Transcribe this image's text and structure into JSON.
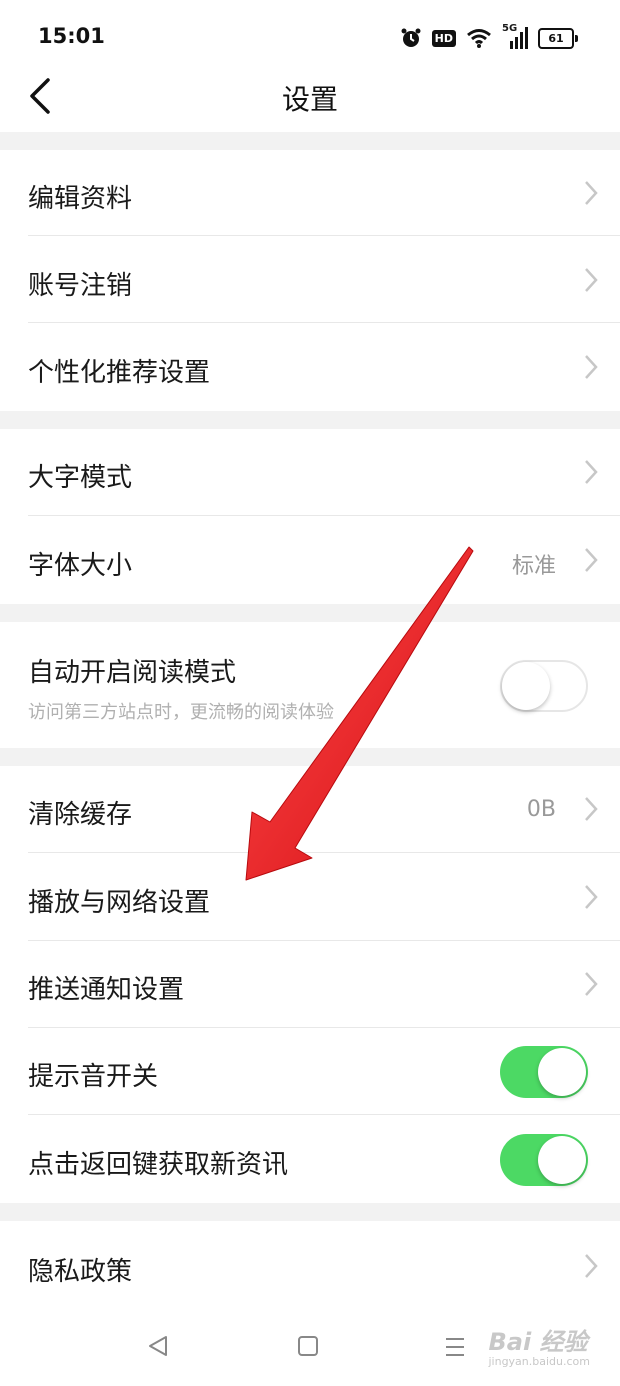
{
  "status_bar": {
    "time": "15:01",
    "hd": "HD",
    "signal": "5G",
    "battery": "61"
  },
  "header": {
    "title": "设置"
  },
  "sections": {
    "account": {
      "edit_profile": "编辑资料",
      "cancel_account": "账号注销",
      "personalized": "个性化推荐设置"
    },
    "display": {
      "large_text": "大字模式",
      "font_size": "字体大小",
      "font_size_value": "标准"
    },
    "reading": {
      "auto_read": "自动开启阅读模式",
      "auto_read_desc": "访问第三方站点时，更流畅的阅读体验",
      "auto_read_on": false
    },
    "misc": {
      "clear_cache": "清除缓存",
      "cache_value": "0B",
      "play_network": "播放与网络设置",
      "push_notify": "推送通知设置",
      "sound": "提示音开关",
      "sound_on": true,
      "back_refresh": "点击返回键获取新资讯",
      "back_refresh_on": true
    },
    "privacy": {
      "policy": "隐私政策"
    }
  },
  "watermark": {
    "brand": "Bai 经验",
    "url": "jingyan.baidu.com"
  },
  "colors": {
    "toggle_on": "#4cd964",
    "arrow": "#e3151a",
    "section_gap": "#f2f2f2"
  },
  "icons": [
    "back-chevron-icon",
    "chevron-right-icon",
    "alarm-icon",
    "wifi-icon",
    "signal-icon",
    "battery-icon",
    "nav-back-icon",
    "nav-home-icon",
    "nav-menu-icon",
    "red-arrow-annotation"
  ]
}
